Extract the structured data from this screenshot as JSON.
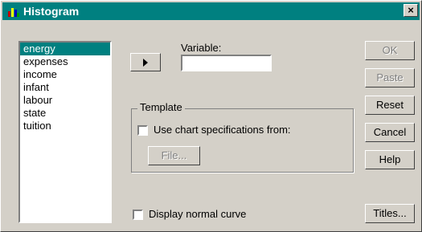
{
  "window": {
    "title": "Histogram",
    "close_glyph": "×"
  },
  "source_list": {
    "items": [
      "energy",
      "expenses",
      "income",
      "infant",
      "labour",
      "state",
      "tuition"
    ],
    "selected": "energy"
  },
  "variable": {
    "label": "Variable:",
    "value": ""
  },
  "template": {
    "group_label": "Template",
    "use_chart_spec_label": "Use chart specifications from:",
    "use_chart_spec_checked": false,
    "file_button": "File..."
  },
  "display_normal_curve": {
    "label": "Display normal curve",
    "checked": false
  },
  "buttons": {
    "ok": "OK",
    "paste": "Paste",
    "reset": "Reset",
    "cancel": "Cancel",
    "help": "Help",
    "titles": "Titles..."
  },
  "colors": {
    "titlebar": "#008080",
    "selection": "#008080",
    "dialog_face": "#d4d0c8"
  },
  "icons": {
    "app": "histogram-app-icon",
    "move": "right-arrow-icon"
  }
}
